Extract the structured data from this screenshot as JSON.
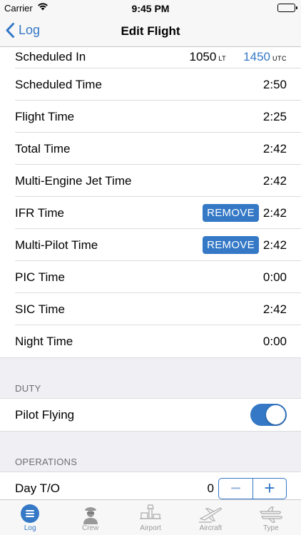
{
  "status": {
    "carrier": "Carrier",
    "time": "9:45 PM"
  },
  "nav": {
    "back_label": "Log",
    "title": "Edit Flight"
  },
  "times": {
    "scheduled_in": {
      "label": "Scheduled In",
      "lt_value": "1050",
      "lt_unit": "LT",
      "utc_value": "1450",
      "utc_unit": "UTC"
    },
    "rows": [
      {
        "label": "Scheduled Time",
        "value": "2:50"
      },
      {
        "label": "Flight Time",
        "value": "2:25"
      },
      {
        "label": "Total Time",
        "value": "2:42"
      },
      {
        "label": "Multi-Engine Jet Time",
        "value": "2:42"
      },
      {
        "label": "IFR Time",
        "value": "2:42",
        "action": "REMOVE"
      },
      {
        "label": "Multi-Pilot Time",
        "value": "2:42",
        "action": "REMOVE"
      },
      {
        "label": "PIC Time",
        "value": "0:00"
      },
      {
        "label": "SIC Time",
        "value": "2:42"
      },
      {
        "label": "Night Time",
        "value": "0:00"
      }
    ]
  },
  "duty": {
    "header": "DUTY",
    "pilot_flying_label": "Pilot Flying",
    "pilot_flying_on": true
  },
  "operations": {
    "header": "OPERATIONS",
    "day_to": {
      "label": "Day T/O",
      "count": "0",
      "minus": "−",
      "plus": "+"
    }
  },
  "tabs": [
    {
      "label": "Log",
      "icon": "list-icon",
      "active": true
    },
    {
      "label": "Crew",
      "icon": "pilot-icon"
    },
    {
      "label": "Airport",
      "icon": "airport-tower-icon"
    },
    {
      "label": "Aircraft",
      "icon": "airplane-icon"
    },
    {
      "label": "Type",
      "icon": "aircraft-types-icon"
    }
  ],
  "colors": {
    "accent": "#3478c6",
    "background": "#efeff4",
    "inactive_tab": "#999999"
  }
}
